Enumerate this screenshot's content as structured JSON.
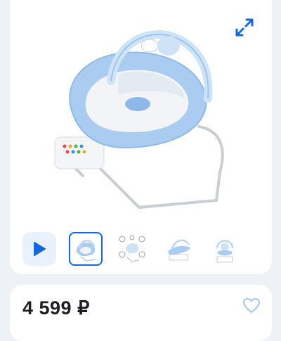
{
  "gallery": {
    "expand_icon": "expand-arrows-icon",
    "main_image": "baby-bouncer-chair-photo",
    "play_icon": "play-icon",
    "thumbnails": [
      {
        "name": "bouncer-front-view",
        "selected": true
      },
      {
        "name": "bouncer-features-diagram",
        "selected": false
      },
      {
        "name": "bouncer-side-view",
        "selected": false
      },
      {
        "name": "bouncer-hanging-toys-view",
        "selected": false
      }
    ]
  },
  "product": {
    "price": "4 599 ₽",
    "favorite_icon": "heart-outline-icon"
  },
  "colors": {
    "accent": "#1667d9",
    "play_bg": "#e9f1fb",
    "page_bg": "#eef1f5"
  }
}
